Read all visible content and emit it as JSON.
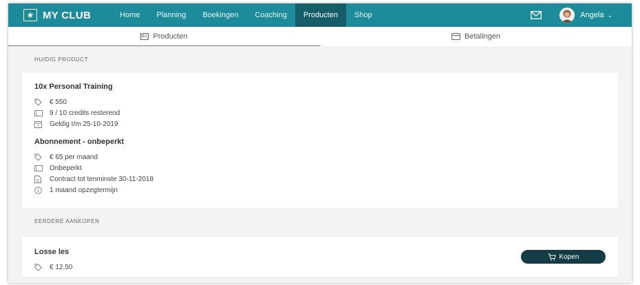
{
  "brand": {
    "name": "MY CLUB",
    "icon": "star-icon"
  },
  "nav": {
    "items": [
      {
        "label": "Home"
      },
      {
        "label": "Planning"
      },
      {
        "label": "Boekingen"
      },
      {
        "label": "Coaching"
      },
      {
        "label": "Producten"
      },
      {
        "label": "Shop"
      }
    ],
    "active": "Producten",
    "user": {
      "name": "Angela"
    }
  },
  "tabs": [
    {
      "label": "Producten",
      "icon": "id-card-icon"
    },
    {
      "label": "Betalingen",
      "icon": "credit-card-icon"
    }
  ],
  "current": {
    "section_label": "HUIDIG PRODUCT",
    "products": [
      {
        "title": "10x Personal Training",
        "lines": [
          {
            "icon": "tag-icon",
            "text": "€ 550"
          },
          {
            "icon": "ticket-icon",
            "text": "9 / 10 credits resterend"
          },
          {
            "icon": "calendar-icon",
            "text": "Geldig t/m 25-10-2019"
          }
        ]
      },
      {
        "title": "Abonnement - onbeperkt",
        "lines": [
          {
            "icon": "tag-icon",
            "text": "€ 65 per maand"
          },
          {
            "icon": "ticket-icon",
            "text": "Onbeperkt"
          },
          {
            "icon": "document-icon",
            "text": "Contract tot tenminste 30-11-2018"
          },
          {
            "icon": "info-icon",
            "text": "1 maand opzegtermijn"
          }
        ]
      }
    ]
  },
  "previous": {
    "section_label": "EERDERE AANKOPEN",
    "items": [
      {
        "title": "Losse les",
        "price": "€ 12,50",
        "button_label": "Kopen"
      }
    ]
  },
  "colors": {
    "navbar": "#1e8b9a",
    "nav_active": "#155e69",
    "button": "#133c47"
  }
}
